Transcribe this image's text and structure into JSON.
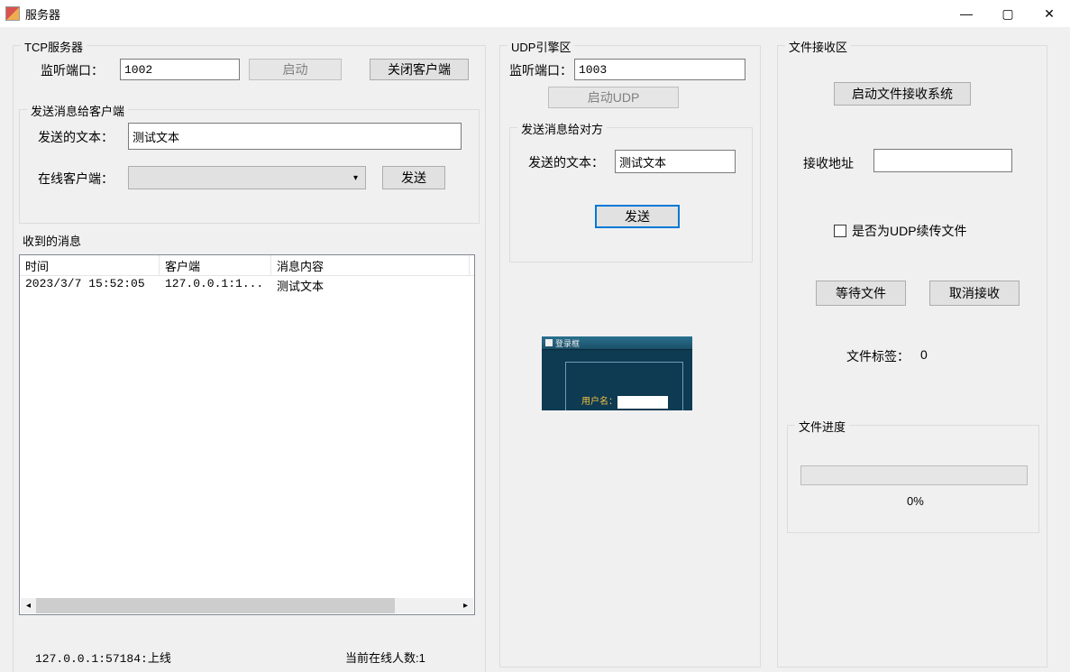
{
  "window": {
    "title": "服务器",
    "min": "—",
    "max": "▢",
    "close": "✕"
  },
  "tcp": {
    "group_label": "TCP服务器",
    "listen_port_label": "监听端口：",
    "listen_port_value": "1002",
    "start_btn": "启动",
    "close_client_btn": "关闭客户端",
    "send_group_label": "发送消息给客户端",
    "send_text_label": "发送的文本：",
    "send_text_value": "测试文本",
    "online_clients_label": "在线客户端：",
    "online_clients_value": "",
    "send_btn": "发送",
    "recv_group_label": "收到的消息",
    "columns": {
      "time": "时间",
      "client": "客户端",
      "content": "消息内容"
    },
    "rows": [
      {
        "time": "2023/3/7 15:52:05",
        "client": "127.0.0.1:1...",
        "content": "测试文本"
      }
    ],
    "status_left": "127.0.0.1:57184:上线",
    "status_right": "当前在线人数:1"
  },
  "udp": {
    "group_label": "UDP引擎区",
    "listen_port_label": "监听端口：",
    "listen_port_value": "1003",
    "start_btn": "启动UDP",
    "send_group_label": "发送消息给对方",
    "send_text_label": "发送的文本：",
    "send_text_value": "测试文本",
    "send_btn": "发送",
    "thumb_title": "登录框",
    "thumb_user_label": "用户名："
  },
  "file": {
    "group_label": "文件接收区",
    "start_btn": "启动文件接收系统",
    "recv_addr_label": "接收地址",
    "recv_addr_value": "",
    "udp_resume_label": "是否为UDP续传文件",
    "wait_btn": "等待文件",
    "cancel_btn": "取消接收",
    "file_tag_label": "文件标签：",
    "file_tag_value": "0",
    "progress_group_label": "文件进度",
    "progress_text": "0%"
  }
}
